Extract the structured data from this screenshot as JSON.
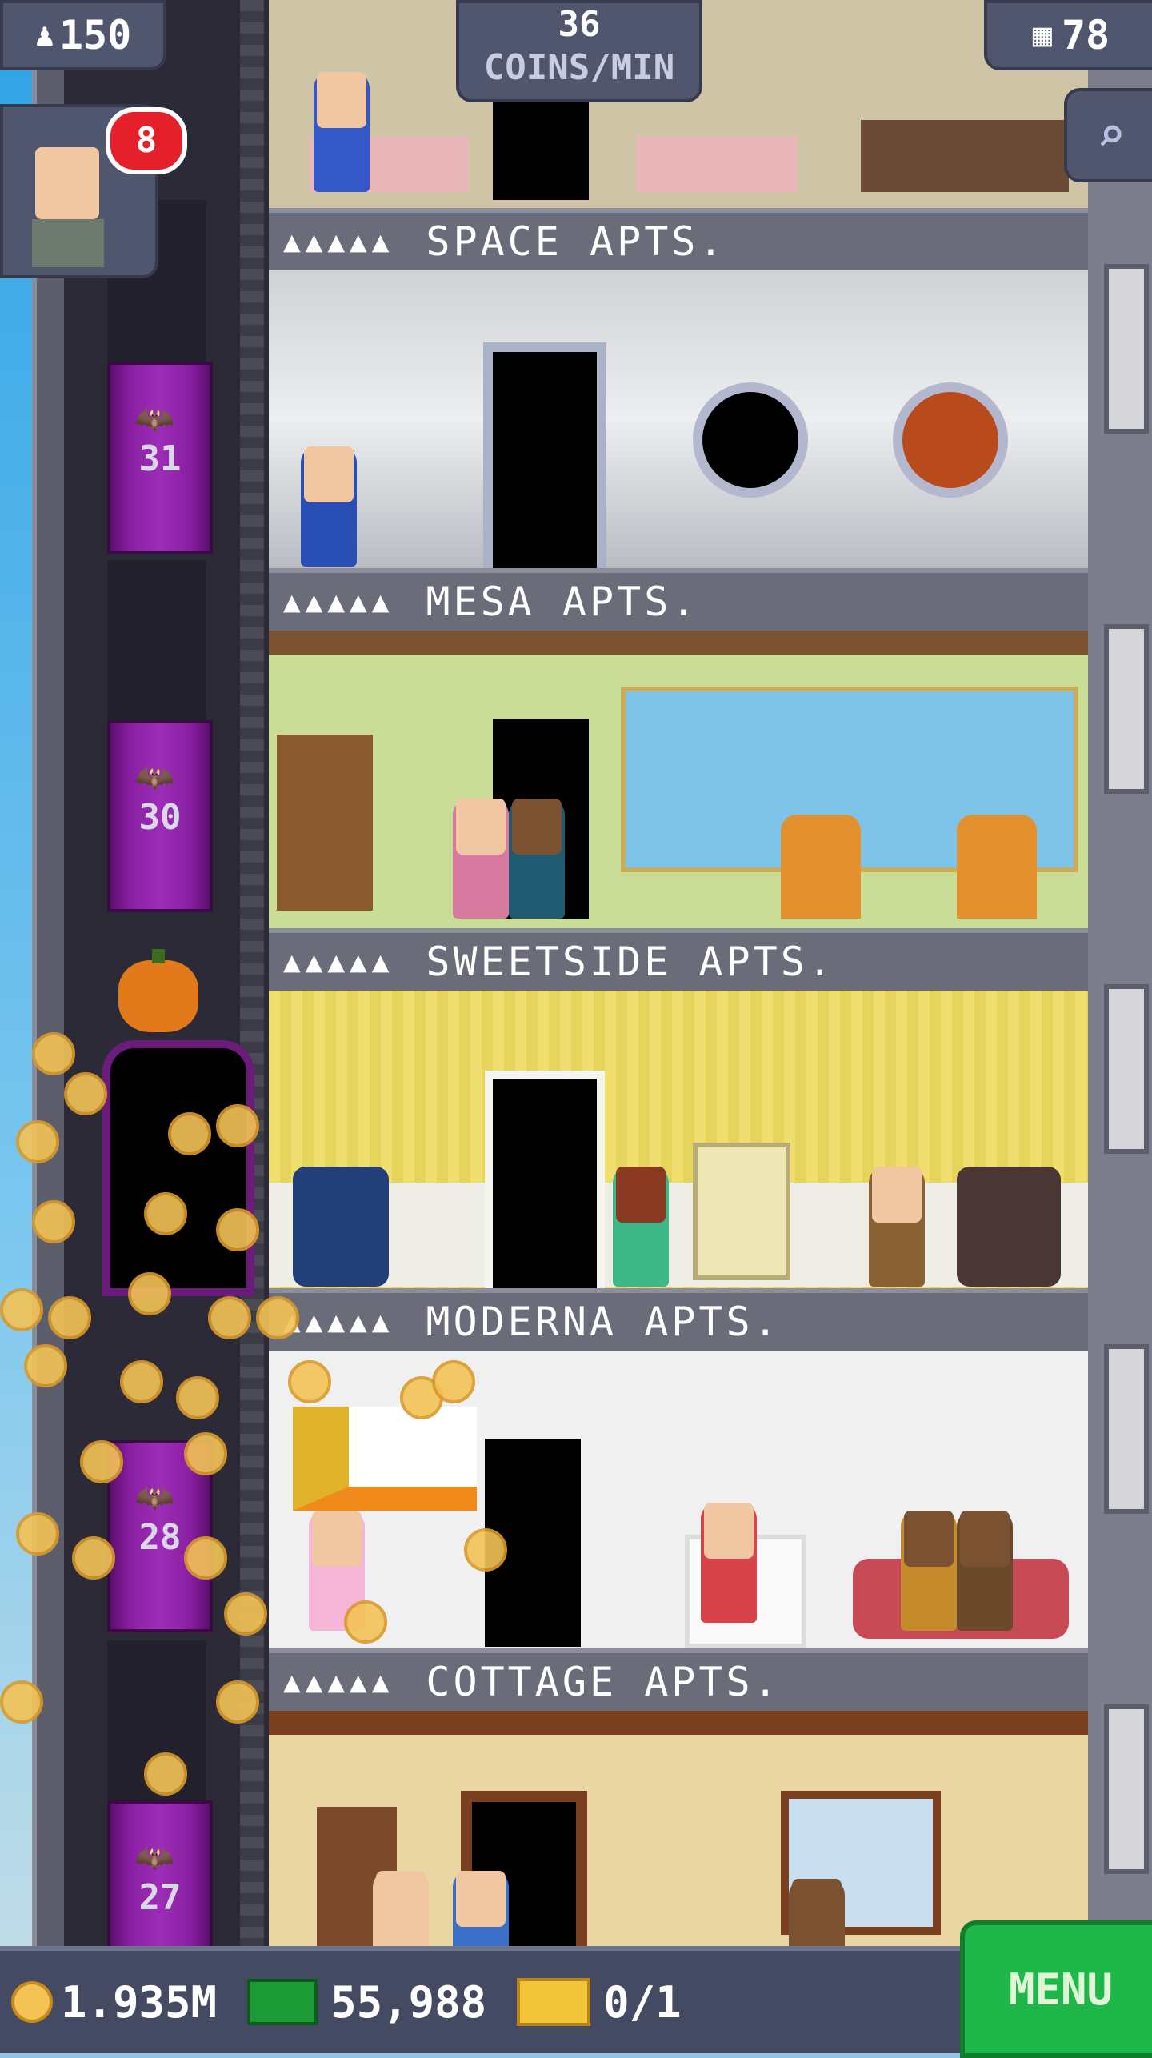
{
  "hud": {
    "population": "150",
    "coins_per_min_value": "36",
    "coins_per_min_label": "COINS/MIN",
    "floors_count": "78",
    "notification_count": "8"
  },
  "floors": [
    {
      "name": "SPACE APTS.",
      "pips": "▲▲▲▲▲"
    },
    {
      "name": "MESA APTS.",
      "pips": "▲▲▲▲▲"
    },
    {
      "name": "SWEETSIDE APTS.",
      "pips": "▲▲▲▲▲"
    },
    {
      "name": "MODERNA APTS.",
      "pips": "▲▲▲▲▲"
    },
    {
      "name": "COTTAGE APTS.",
      "pips": "▲▲▲▲▲"
    }
  ],
  "elevator": {
    "floor_numbers": [
      "31",
      "30",
      "28",
      "27"
    ]
  },
  "bottom": {
    "coins": "1.935M",
    "bux": "55,988",
    "tickets": "0/1",
    "menu_label": "MENU"
  },
  "colors": {
    "accent_green": "#1fb64a",
    "badge_red": "#e5202b",
    "hud_bg": "#51566f"
  }
}
